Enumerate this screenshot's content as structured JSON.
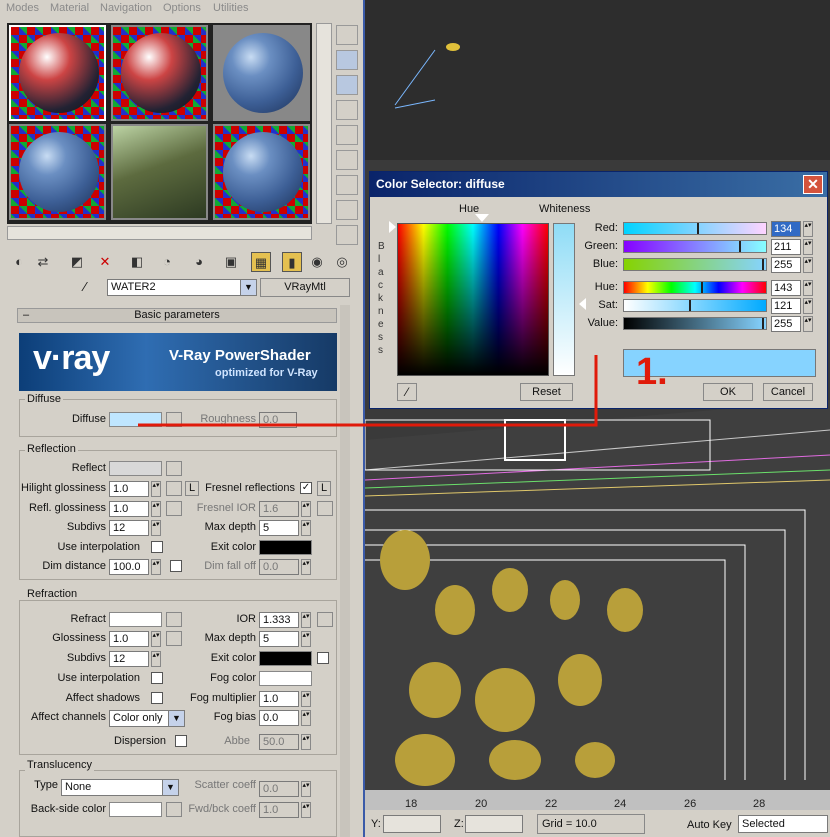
{
  "menu": [
    "Modes",
    "Material",
    "Navigation",
    "Options",
    "Utilities"
  ],
  "material": {
    "name": "WATER2",
    "type": "VRayMtl"
  },
  "rollout": {
    "title": "Basic parameters",
    "banner_title": "V-Ray PowerShader",
    "banner_sub": "optimized for V-Ray",
    "logo": "v·ray"
  },
  "diffuse": {
    "group": "Diffuse",
    "label": "Diffuse",
    "roughness_label": "Roughness",
    "roughness": "0.0",
    "color": "#bfe6ff"
  },
  "reflection": {
    "group": "Reflection",
    "reflect": "Reflect",
    "hilight": "Hilight glossiness",
    "hilight_val": "1.0",
    "L": "L",
    "fresnel": "Fresnel reflections",
    "refl_gloss": "Refl. glossiness",
    "refl_gloss_val": "1.0",
    "fresnel_ior": "Fresnel IOR",
    "fresnel_ior_val": "1.6",
    "subdivs": "Subdivs",
    "subdivs_val": "12",
    "max_depth": "Max depth",
    "max_depth_val": "5",
    "use_interp": "Use interpolation",
    "exit_color": "Exit color",
    "dim_dist": "Dim distance",
    "dim_dist_val": "100.0",
    "dim_falloff": "Dim fall off",
    "dim_falloff_val": "0.0",
    "reflect_color": "#d8d8d8",
    "exit_swatch": "#000000"
  },
  "refraction": {
    "group": "Refraction",
    "refract": "Refract",
    "ior": "IOR",
    "ior_val": "1.333",
    "gloss": "Glossiness",
    "gloss_val": "1.0",
    "max_depth": "Max depth",
    "max_depth_val": "5",
    "subdivs": "Subdivs",
    "subdivs_val": "12",
    "exit_color": "Exit color",
    "use_interp": "Use interpolation",
    "fog_color": "Fog color",
    "affect_shadows": "Affect shadows",
    "fog_mult": "Fog multiplier",
    "fog_mult_val": "1.0",
    "affect_channels": "Affect channels",
    "channels_val": "Color only",
    "fog_bias": "Fog bias",
    "fog_bias_val": "0.0",
    "dispersion": "Dispersion",
    "abbe": "Abbe",
    "abbe_val": "50.0",
    "refract_color": "#ffffff",
    "exit_swatch": "#000000",
    "fog_swatch": "#ffffff"
  },
  "translucency": {
    "group": "Translucency",
    "type": "Type",
    "type_val": "None",
    "scatter": "Scatter coeff",
    "scatter_val": "0.0",
    "backside": "Back-side color",
    "fwd_bck": "Fwd/bck coeff",
    "fwd_bck_val": "1.0"
  },
  "dialog": {
    "title": "Color Selector: diffuse",
    "hue": "Hue",
    "whiteness": "Whiteness",
    "blackness": "B l a c k n e s s",
    "channels": [
      {
        "label": "Red:",
        "value": "134",
        "pos": 0.53
      },
      {
        "label": "Green:",
        "value": "211",
        "pos": 0.83
      },
      {
        "label": "Blue:",
        "value": "255",
        "pos": 1.0
      },
      {
        "label": "Hue:",
        "value": "143",
        "pos": 0.56
      },
      {
        "label": "Sat:",
        "value": "121",
        "pos": 0.47
      },
      {
        "label": "Value:",
        "value": "255",
        "pos": 1.0
      }
    ],
    "reset": "Reset",
    "ok": "OK",
    "cancel": "Cancel",
    "swatch": "#86d3ff"
  },
  "callout": "1.",
  "ruler": [
    "18",
    "20",
    "22",
    "24",
    "26",
    "28"
  ],
  "status": {
    "y_label": "Y:",
    "z_label": "Z:",
    "grid": "Grid = 10.0",
    "autokey": "Auto Key",
    "selected": "Selected"
  }
}
